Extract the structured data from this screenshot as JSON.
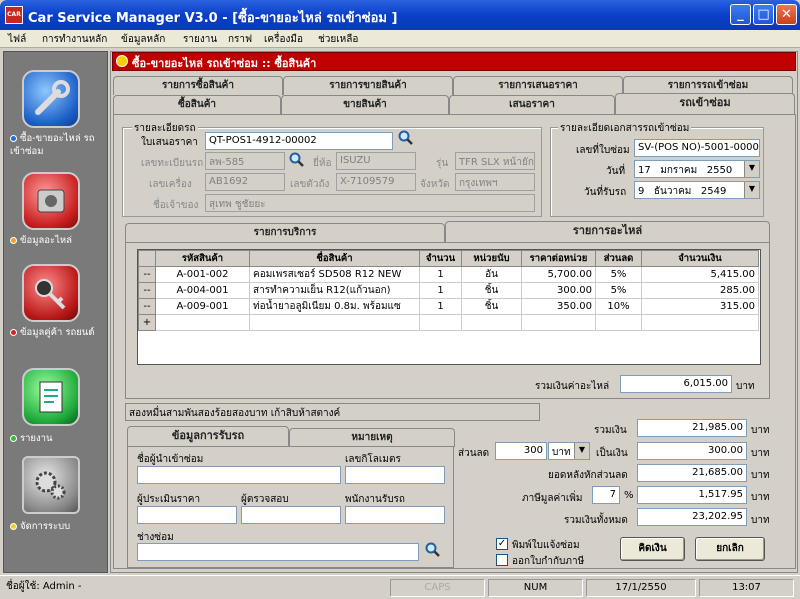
{
  "window": {
    "app_icon_text": "CAR",
    "title": "Car Service Manager V3.0 - [ซื้อ-ขายอะไหล่ รถเข้าซ่อม ]",
    "min": "_",
    "max": "□",
    "close": "✕"
  },
  "menu": [
    "ไฟล์",
    "การทำงานหลัก",
    "ข้อมูลหลัก",
    "รายงาน",
    "กราฟ",
    "เครื่องมือ",
    "ช่วยเหลือ"
  ],
  "sidebar": {
    "items": [
      {
        "label": "ซื้อ-ขายอะไหล่ รถเข้าซ่อม",
        "dot": "#1e6fd8",
        "icon": "wrench-icon"
      },
      {
        "label": "ข้อมูลอะไหล่",
        "dot": "#f0a020",
        "icon": "engine-icon"
      },
      {
        "label": "ข้อมูลคู่ค้า รถยนต์",
        "dot": "#e02020",
        "icon": "key-icon"
      },
      {
        "label": "รายงาน",
        "dot": "#30c030",
        "icon": "report-icon"
      },
      {
        "label": "จัดการระบบ",
        "dot": "#f0d020",
        "icon": "gears-icon"
      }
    ]
  },
  "inner_title": "ซื้อ-ขายอะไหล่ รถเข้าซ่อม :: ซื้อสินค้า",
  "tabs_back": [
    "รายการซื้อสินค้า",
    "รายการขายสินค้า",
    "รายการเสนอราคา",
    "รายการรถเข้าซ่อม"
  ],
  "tabs_front": [
    "ซื้อสินค้า",
    "ขายสินค้า",
    "เสนอราคา",
    "รถเข้าซ่อม"
  ],
  "car_group": {
    "title": "รายละเอียดรถ",
    "quote_label": "ใบเสนอราคา",
    "quote_value": "QT-POS1-4912-00002",
    "plate_label": "เลขทะเบียนรถ",
    "plate_value": "ลพ-585",
    "brand_label": "ยี่ห้อ",
    "brand_value": "ISUZU",
    "model_label": "รุ่น",
    "model_value": "TFR SLX หน้ายัก",
    "engine_label": "เลขเครื่อง",
    "engine_value": "AB1692",
    "chassis_label": "เลขตัวถัง",
    "chassis_value": "X-7109579",
    "province_label": "จังหวัด",
    "province_value": "กรุงเทพฯ",
    "owner_label": "ชื่อเจ้าของ",
    "owner_value": "สุเทพ ชูชัยยะ"
  },
  "doc_group": {
    "title": "รายละเอียดเอกสารรถเข้าซ่อม",
    "repair_no_label": "เลขที่ใบซ่อม",
    "repair_no_value": "SV-(POS NO)-5001-00007",
    "date_label": "วันที่",
    "date_day": "17",
    "date_month": "มกราคม",
    "date_year": "2550",
    "receive_label": "วันที่รับรถ",
    "receive_day": "9",
    "receive_month": "ธันวาคม",
    "receive_year": "2549"
  },
  "sub_tabs": [
    "รายการบริการ",
    "รายการอะไหล่"
  ],
  "parts_table": {
    "headers": [
      "รหัสสินค้า",
      "ชื่อสินค้า",
      "จำนวน",
      "หน่วยนับ",
      "ราคาต่อหน่วย",
      "ส่วนลด",
      "จำนวนเงิน"
    ],
    "rows": [
      {
        "marker": "--",
        "code": "A-001-002",
        "name": "คอมเพรสเซอร์ SD508 R12 NEW",
        "qty": "1",
        "unit": "อัน",
        "price": "5,700.00",
        "disc": "5%",
        "amount": "5,415.00"
      },
      {
        "marker": "--",
        "code": "A-004-001",
        "name": "สารทำความเย็น R12(แก้วนอก)",
        "qty": "1",
        "unit": "ชิ้น",
        "price": "300.00",
        "disc": "5%",
        "amount": "285.00"
      },
      {
        "marker": "--",
        "code": "A-009-001",
        "name": "ท่อน้ำยาอลูมิเนียม 0.8ม. พร้อมแซ",
        "qty": "1",
        "unit": "ชิ้น",
        "price": "350.00",
        "disc": "10%",
        "amount": "315.00"
      }
    ],
    "new_row_marker": "+"
  },
  "parts_total_label": "รวมเงินค่าอะไหล่",
  "parts_total_value": "6,015.00",
  "baht": "บาท",
  "amount_text": "สองหมื่นสามพันสองร้อยสองบาท เก้าสิบห้าสตางค์",
  "bottom_tabs": [
    "ข้อมูลการรับรถ",
    "หมายเหตุ"
  ],
  "receive_info": {
    "sender_label": "ชื่อผู้นำเข้าซ่อม",
    "mileage_label": "เลขกิโลเมตร",
    "estimator_label": "ผู้ประเมินราคา",
    "checker_label": "ผู้ตรวจสอบ",
    "receiver_label": "พนักงานรับรถ",
    "mechanic_label": "ช่างซ่อม"
  },
  "totals": {
    "sum_label": "รวมเงิน",
    "sum_value": "21,985.00",
    "discount_label": "ส่วนลด",
    "discount_input": "300",
    "discount_unit": "บาท",
    "discount_as_label": "เป็นเงิน",
    "discount_value": "300.00",
    "after_label": "ยอดหลังหักส่วนลด",
    "after_value": "21,685.00",
    "vat_label": "ภาษีมูลค่าเพิ่ม",
    "vat_rate": "7",
    "vat_pct": "%",
    "vat_value": "1,517.95",
    "grand_label": "รวมเงินทั้งหมด",
    "grand_value": "23,202.95"
  },
  "print_repair_label": "พิมพ์ใบแจ้งซ่อม",
  "print_repair_checked": true,
  "print_tax_label": "ออกใบกำกับภาษี",
  "print_tax_checked": false,
  "calc_button": "คิดเงิน",
  "cancel_button": "ยกเลิก",
  "status": {
    "user": "ชื่อผู้ใช้: Admin -",
    "caps": "CAPS",
    "num": "NUM",
    "date": "17/1/2550",
    "time": "13:07"
  }
}
